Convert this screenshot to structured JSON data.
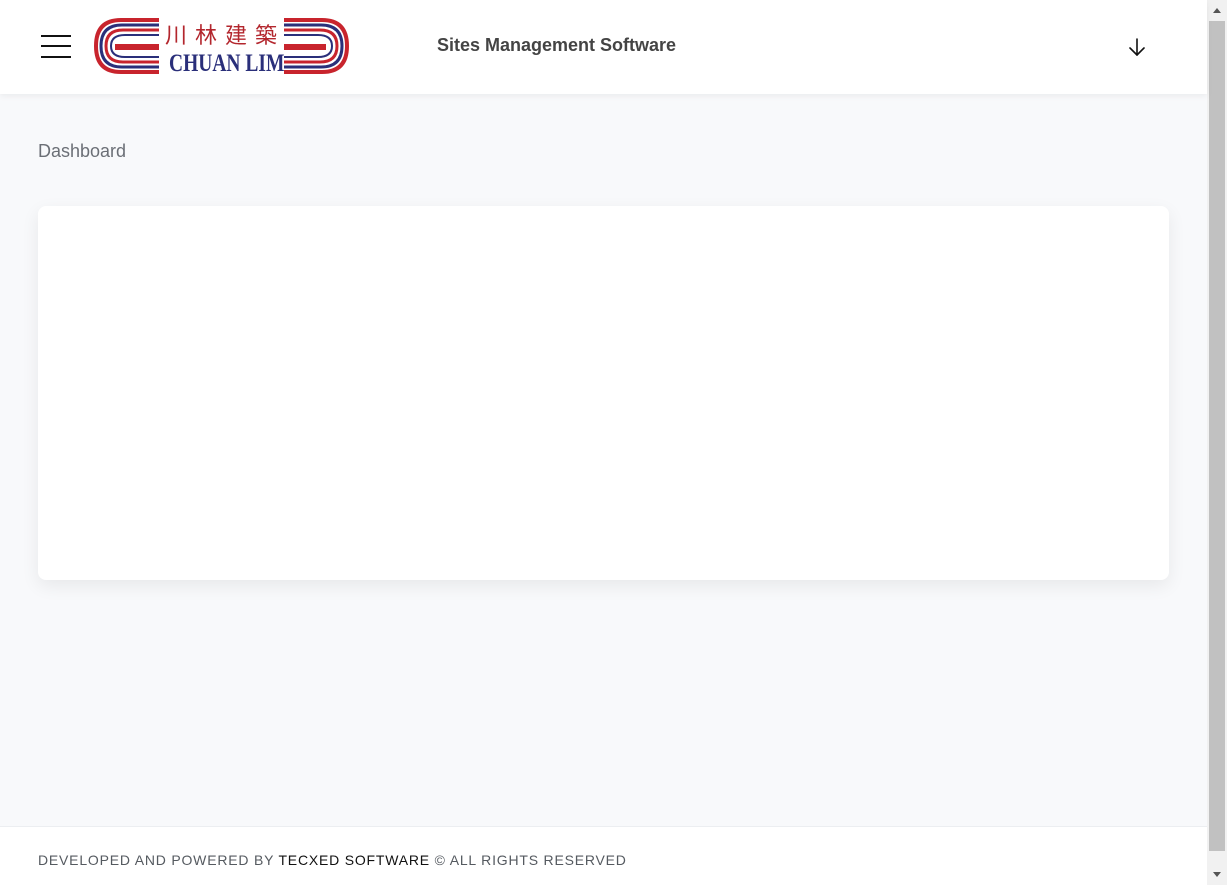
{
  "header": {
    "menu_icon": "hamburger-menu-icon",
    "logo": {
      "chinese_text": "川林建築",
      "english_text": "CHUAN LIM",
      "colors": {
        "red": "#c8242d",
        "blue": "#2a2f7a"
      }
    },
    "title": "Sites Management Software",
    "action_icon": "arrow-down-icon"
  },
  "breadcrumb": {
    "current": "Dashboard"
  },
  "footer": {
    "prefix": "DEVELOPED AND POWERED BY",
    "company": "TECXED SOFTWARE",
    "suffix": "© ALL RIGHTS RESERVED"
  },
  "colors": {
    "page_background": "#f8f9fb",
    "card_background": "#ffffff",
    "header_text": "#444444"
  }
}
